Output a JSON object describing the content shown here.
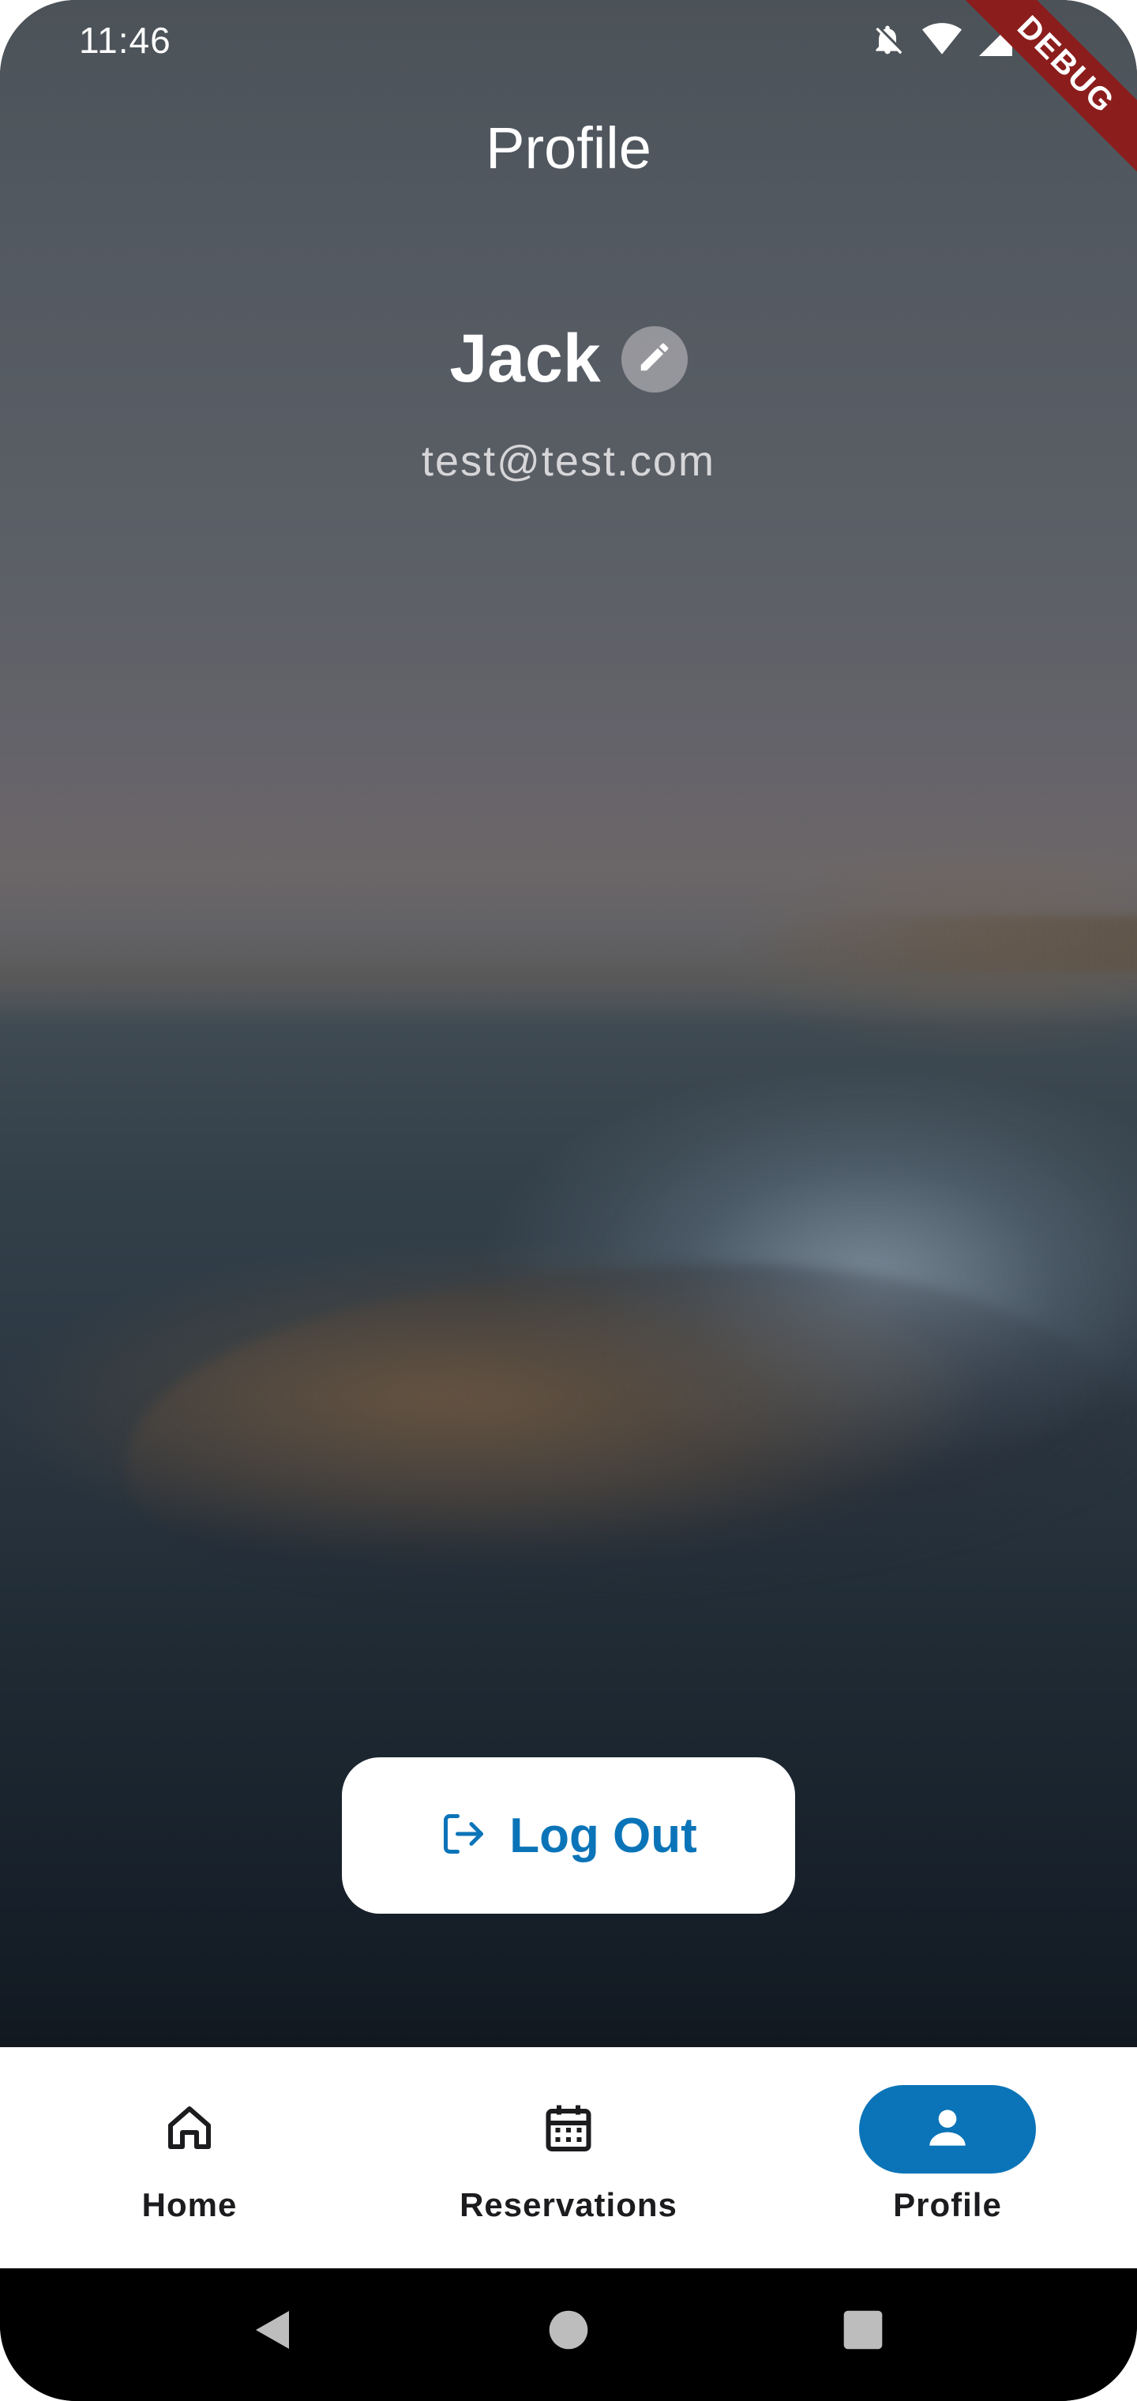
{
  "status_bar": {
    "time": "11:46",
    "icons": [
      "notifications-off-icon",
      "wifi-icon",
      "signal-icon",
      "battery-icon"
    ]
  },
  "debug_banner": "DEBUG",
  "header": {
    "title": "Profile"
  },
  "profile": {
    "name": "Jack",
    "email": "test@test.com",
    "edit_icon": "edit-pencil-icon"
  },
  "actions": {
    "logout_label": "Log Out",
    "logout_icon": "logout-icon"
  },
  "bottom_nav": {
    "items": [
      {
        "label": "Home",
        "icon": "home-icon",
        "active": false
      },
      {
        "label": "Reservations",
        "icon": "calendar-icon",
        "active": false
      },
      {
        "label": "Profile",
        "icon": "person-icon",
        "active": true
      }
    ]
  },
  "system_nav": {
    "icons": [
      "back-icon",
      "home-circle-icon",
      "recents-icon"
    ]
  },
  "colors": {
    "accent": "#0b74b8",
    "nav_background": "#ffffff",
    "debug_banner": "#8b1d1d"
  }
}
